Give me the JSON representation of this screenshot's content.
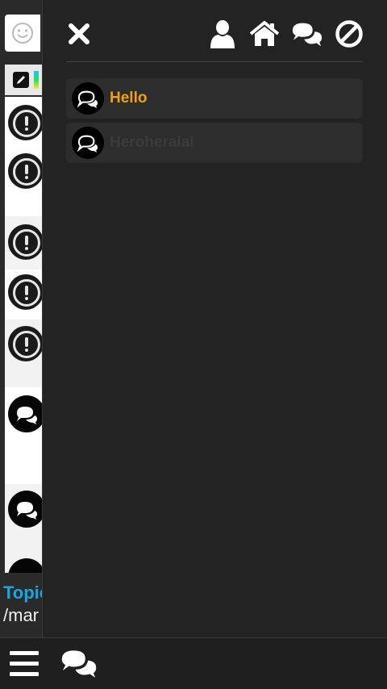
{
  "background_chat": {
    "topic_label": "Topic",
    "path_fragment": "/mar"
  },
  "drawer": {
    "header_icons": [
      "close-icon",
      "user-icon",
      "home-icon",
      "chats-icon",
      "block-icon"
    ],
    "rooms": [
      {
        "name": "Hello",
        "state": "active",
        "color": "#f1a10d"
      },
      {
        "name": "Heroheralai",
        "state": "inactive",
        "color": "#3b3b3b"
      }
    ]
  },
  "bottom_bar": {
    "icons": [
      "hamburger-menu-icon",
      "chats-icon"
    ]
  },
  "colors": {
    "drawer_bg": "#232323",
    "accent": "#f1a10d",
    "topic_link": "#1aa6e0"
  }
}
